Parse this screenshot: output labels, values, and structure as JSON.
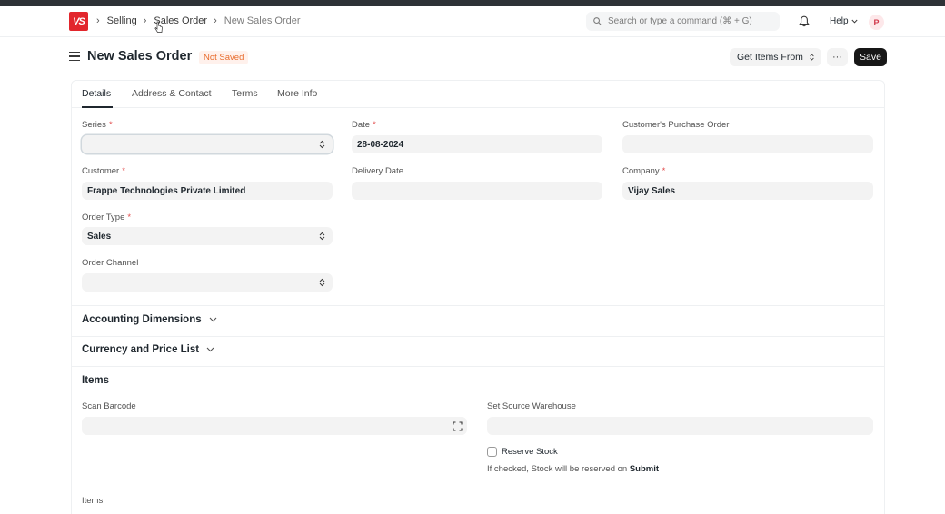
{
  "navbar": {
    "logo_text": "VS",
    "breadcrumbs": [
      "Selling",
      "Sales Order",
      "New Sales Order"
    ],
    "search_placeholder": "Search or type a command (⌘ + G)",
    "help_label": "Help",
    "avatar_initial": "P"
  },
  "header": {
    "title": "New Sales Order",
    "status": "Not Saved",
    "get_items_label": "Get Items From",
    "more_label": "···",
    "save_label": "Save"
  },
  "tabs": [
    "Details",
    "Address & Contact",
    "Terms",
    "More Info"
  ],
  "form": {
    "series": {
      "label": "Series",
      "value": ""
    },
    "date": {
      "label": "Date",
      "value": "28-08-2024"
    },
    "customer_po": {
      "label": "Customer's Purchase Order",
      "value": ""
    },
    "customer": {
      "label": "Customer",
      "value": "Frappe Technologies Private Limited"
    },
    "delivery_date": {
      "label": "Delivery Date",
      "value": ""
    },
    "company": {
      "label": "Company",
      "value": "Vijay Sales"
    },
    "order_type": {
      "label": "Order Type",
      "value": "Sales"
    },
    "order_channel": {
      "label": "Order Channel",
      "value": ""
    }
  },
  "sections": {
    "accounting": "Accounting Dimensions",
    "currency": "Currency and Price List",
    "items": "Items"
  },
  "items_section": {
    "scan_barcode_label": "Scan Barcode",
    "source_warehouse_label": "Set Source Warehouse",
    "reserve_stock_label": "Reserve Stock",
    "help_prefix": "If checked, Stock will be reserved on ",
    "help_bold": "Submit",
    "items_table_label": "Items"
  },
  "colors": {
    "accent_dark": "#171717",
    "status_orange": "#e86c2d",
    "logo_red": "#e2262c",
    "required_red": "#e24c4c"
  }
}
